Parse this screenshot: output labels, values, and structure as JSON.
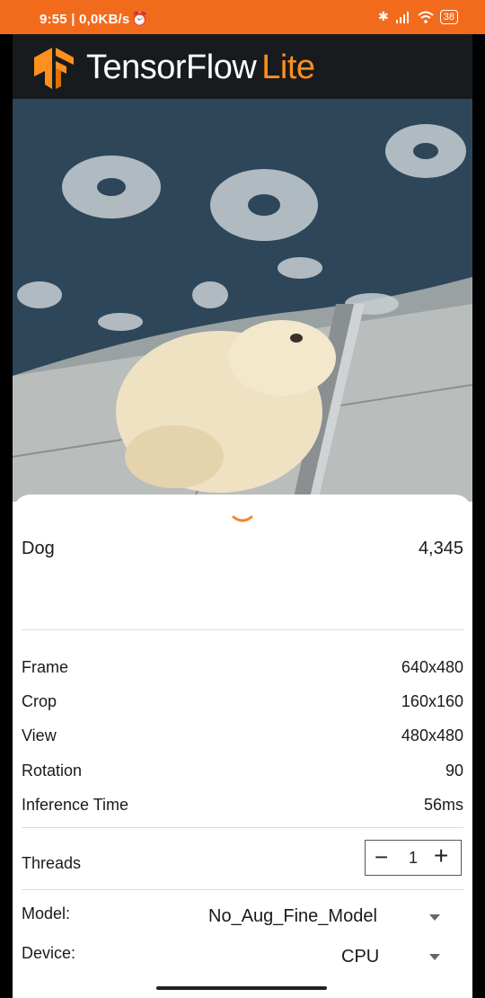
{
  "status_bar": {
    "time": "9:55 | 0,0KB/s",
    "battery": "38"
  },
  "app": {
    "brand_main": "TensorFlow",
    "brand_accent": "Lite"
  },
  "result": {
    "label": "Dog",
    "score": "4,345"
  },
  "info": [
    {
      "label": "Frame",
      "value": "640x480"
    },
    {
      "label": "Crop",
      "value": "160x160"
    },
    {
      "label": "View",
      "value": "480x480"
    },
    {
      "label": "Rotation",
      "value": "90"
    },
    {
      "label": "Inference Time",
      "value": "56ms"
    }
  ],
  "threads": {
    "label": "Threads",
    "value": "1",
    "minus": "−",
    "plus": "+"
  },
  "model": {
    "label": "Model:",
    "value": "No_Aug_Fine_Model"
  },
  "device": {
    "label": "Device:",
    "value": "CPU"
  },
  "colors": {
    "accent": "#f26b1d",
    "brand_lite": "#ff8f1f"
  },
  "icons": {
    "alarm": "alarm-icon",
    "bluetooth": "bluetooth-icon",
    "signal": "signal-icon",
    "wifi": "wifi-icon",
    "chevron": "chevron-down-icon",
    "dropdown": "caret-down-icon"
  }
}
